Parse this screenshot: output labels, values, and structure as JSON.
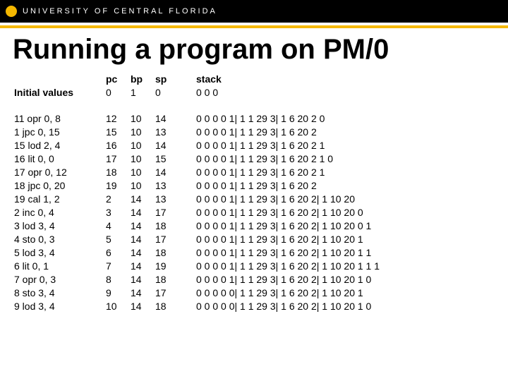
{
  "header": {
    "univ_name": "UNIVERSITY OF CENTRAL FLORIDA"
  },
  "slide": {
    "title": "Running a program on PM/0"
  },
  "table": {
    "columns": {
      "inst": "Initial values",
      "pc": "pc",
      "bp": "bp",
      "sp": "sp",
      "stack": "stack"
    },
    "initial": {
      "pc": "0",
      "bp": "1",
      "sp": "0",
      "stack": "0 0 0"
    },
    "rows": [
      {
        "inst": "11  opr   0, 8",
        "pc": "12",
        "bp": "10",
        "sp": "14",
        "stack": "0 0 0 0 1| 1 1 29 3| 1 6 20 2 0"
      },
      {
        "inst": "1 jpc    0, 15",
        "pc": "15",
        "bp": "10",
        "sp": "13",
        "stack": "0 0 0 0 1| 1 1 29 3| 1 6 20 2"
      },
      {
        "inst": "15  lod  2, 4",
        "pc": "16",
        "bp": "10",
        "sp": "14",
        "stack": "0 0 0 0 1| 1 1 29 3| 1 6 20 2 1"
      },
      {
        "inst": "16 lit   0, 0",
        "pc": "17",
        "bp": "10",
        "sp": "15",
        "stack": "0 0 0 0 1| 1 1 29 3| 1 6 20 2 1 0"
      },
      {
        "inst": "17 opr  0, 12",
        "pc": "18",
        "bp": "10",
        "sp": "14",
        "stack": "0 0 0 0 1| 1 1 29 3| 1 6 20 2 1"
      },
      {
        "inst": "18 jpc   0, 20",
        "pc": "19",
        "bp": "10",
        "sp": "13",
        "stack": "0 0 0 0 1| 1 1 29 3| 1 6 20 2"
      },
      {
        "inst": "19 cal    1, 2",
        "pc": "2",
        "bp": "14",
        "sp": "13",
        "stack": "0 0 0 0 1| 1 1 29 3| 1 6 20 2| 1 10 20"
      },
      {
        "inst": " 2 inc    0, 4",
        "pc": "3",
        "bp": "14",
        "sp": "17",
        "stack": "0 0 0 0 1| 1 1 29 3| 1 6 20 2| 1 10 20 0"
      },
      {
        "inst": " 3 lod    3, 4",
        "pc": "4",
        "bp": "14",
        "sp": "18",
        "stack": "0 0 0 0 1| 1 1 29 3| 1 6 20 2| 1 10 20 0 1"
      },
      {
        "inst": " 4 sto   0, 3",
        "pc": "5",
        "bp": "14",
        "sp": "17",
        "stack": "0 0 0 0 1| 1 1 29 3| 1 6 20 2| 1 10 20 1"
      },
      {
        "inst": " 5 lod    3, 4",
        "pc": "6",
        "bp": "14",
        "sp": "18",
        "stack": "0 0 0 0 1| 1 1 29 3| 1 6 20 2| 1 10 20 1 1"
      },
      {
        "inst": " 6 lit   0, 1",
        "pc": "7",
        "bp": "14",
        "sp": "19",
        "stack": "0 0 0 0 1| 1 1 29 3| 1 6 20 2| 1 10 20 1 1 1"
      },
      {
        "inst": " 7 opr   0, 3",
        "pc": "8",
        "bp": "14",
        "sp": "18",
        "stack": "0 0 0 0 1| 1 1 29 3| 1 6 20 2| 1 10 20 1 0"
      },
      {
        "inst": " 8 sto    3, 4",
        "pc": "9",
        "bp": "14",
        "sp": "17",
        "stack": "0 0 0 0 0| 1 1 29 3| 1 6 20 2| 1 10 20 1"
      },
      {
        "inst": " 9 lod    3, 4",
        "pc": "10",
        "bp": "14",
        "sp": "18",
        "stack": "0 0 0 0 0| 1 1 29 3| 1 6 20 2| 1 10 20 1 0"
      }
    ]
  }
}
